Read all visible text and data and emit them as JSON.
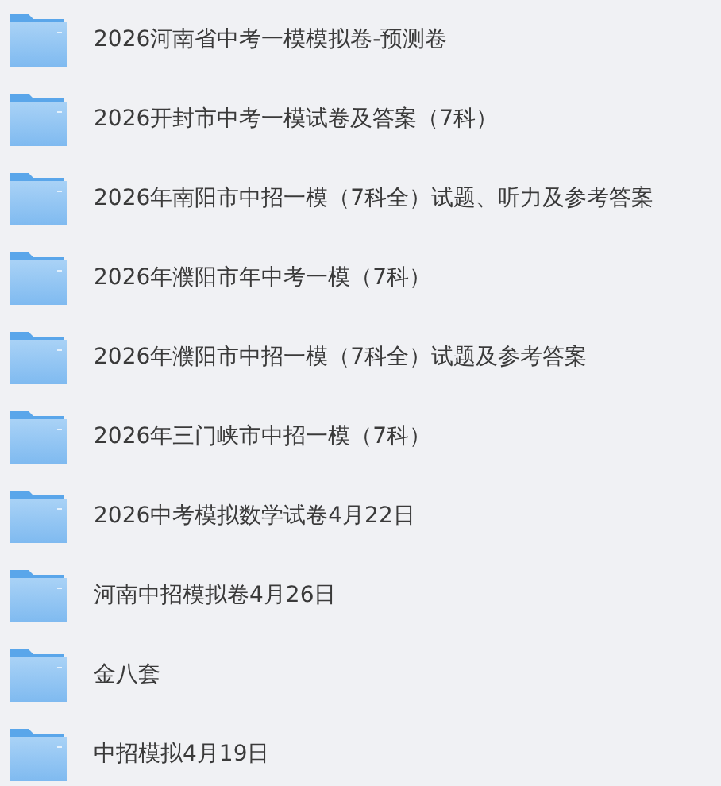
{
  "folders": [
    {
      "name": "2026河南省中考一模模拟卷-预测卷"
    },
    {
      "name": "2026开封市中考一模试卷及答案（7科）"
    },
    {
      "name": "2026年南阳市中招一模（7科全）试题、听力及参考答案"
    },
    {
      "name": "2026年濮阳市年中考一模（7科）"
    },
    {
      "name": "2026年濮阳市中招一模（7科全）试题及参考答案"
    },
    {
      "name": "2026年三门峡市中招一模（7科）"
    },
    {
      "name": "2026中考模拟数学试卷4月22日"
    },
    {
      "name": "河南中招模拟卷4月26日"
    },
    {
      "name": "金八套"
    },
    {
      "name": "中招模拟4月19日"
    }
  ]
}
